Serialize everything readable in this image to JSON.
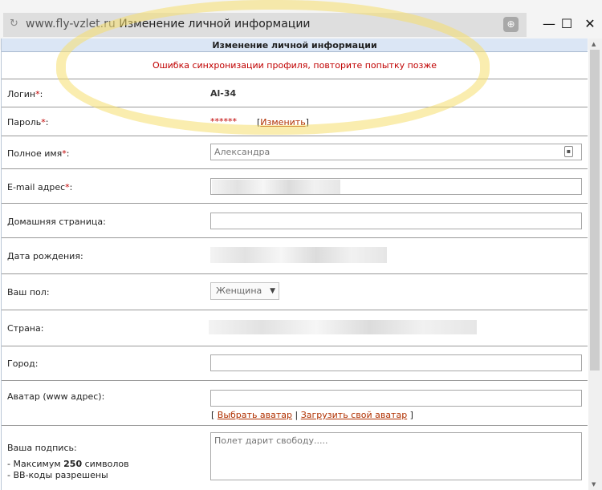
{
  "browser": {
    "host": "www.fly-vzlet.ru",
    "title": "Изменение личной информации"
  },
  "panel": {
    "heading": "Изменение личной информации",
    "error": "Ошибка синхронизации профиля, повторите попытку позже"
  },
  "form": {
    "login": {
      "label": "Логин",
      "req": "*",
      "value": "Al-34"
    },
    "password": {
      "label": "Пароль",
      "req": "*",
      "value": "******",
      "change_link": "Изменить"
    },
    "fullname": {
      "label": "Полное имя",
      "req": "*",
      "value": "Александра"
    },
    "email": {
      "label": "E-mail адрес",
      "req": "*"
    },
    "homepage": {
      "label": "Домашняя страница"
    },
    "birthdate": {
      "label": "Дата рождения"
    },
    "gender": {
      "label": "Ваш пол",
      "selected": "Женщина"
    },
    "country": {
      "label": "Страна"
    },
    "city": {
      "label": "Город"
    },
    "avatar": {
      "label": "Аватар (www адрес)",
      "choose_link": "Выбрать аватар",
      "upload_link": "Загрузить свой аватар"
    },
    "signature": {
      "label": "Ваша подпись",
      "hint_prefix": "- Максимум ",
      "hint_max": "250",
      "hint_suffix": " символов",
      "hint_bb": "- BB-коды разрешены",
      "placeholder": "Полет дарит свободу....."
    }
  },
  "colors": {
    "required": "#c00000",
    "error": "#c00000",
    "link": "#b03000",
    "header_bg": "#dbe6f5"
  }
}
